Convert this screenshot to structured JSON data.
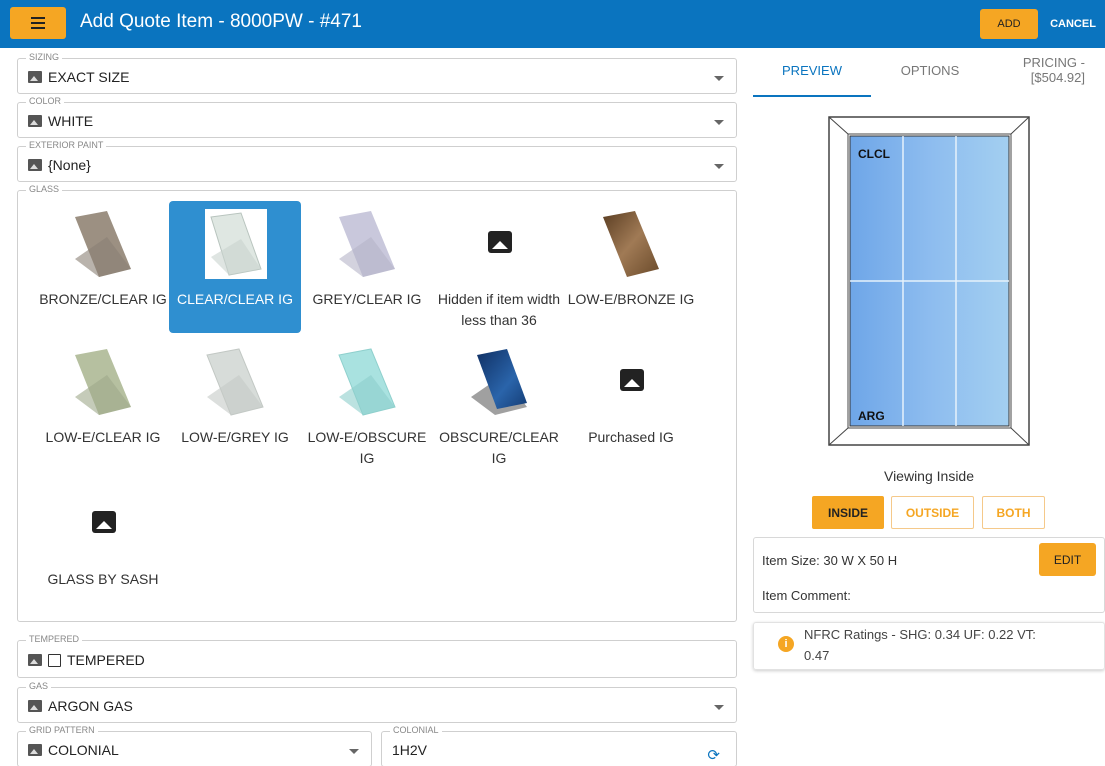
{
  "header": {
    "title": "Add Quote Item - 8000PW - #471",
    "add_label": "ADD",
    "cancel_label": "CANCEL"
  },
  "fields": {
    "sizing": {
      "label": "SIZING",
      "value": "EXACT SIZE"
    },
    "color": {
      "label": "COLOR",
      "value": "WHITE"
    },
    "exterior_paint": {
      "label": "EXTERIOR PAINT",
      "value": "{None}"
    },
    "glass": {
      "label": "GLASS"
    },
    "tempered": {
      "label": "TEMPERED",
      "value": "TEMPERED",
      "checked": false
    },
    "gas": {
      "label": "GAS",
      "value": "ARGON GAS"
    },
    "grid_pattern": {
      "label": "GRID PATTERN",
      "value": "COLONIAL"
    },
    "colonial": {
      "label": "COLONIAL",
      "value": "1H2V"
    }
  },
  "glass_options": [
    {
      "label": "BRONZE/CLEAR IG",
      "icon": "bronze-glass-swatch",
      "color": "#a09486"
    },
    {
      "label": "CLEAR/CLEAR IG",
      "icon": "clear-glass-swatch",
      "color": "#e6ece8",
      "selected": true
    },
    {
      "label": "GREY/CLEAR IG",
      "icon": "grey-glass-swatch",
      "color": "#c8c8dc"
    },
    {
      "label": "Hidden if item width less than 36",
      "icon": "image-placeholder-icon"
    },
    {
      "label": "LOW-E/BRONZE IG",
      "icon": "lowe-bronze-swatch",
      "color": "#7a5a3a"
    },
    {
      "label": "LOW-E/CLEAR IG",
      "icon": "lowe-clear-swatch",
      "color": "#b9c2a4"
    },
    {
      "label": "LOW-E/GREY IG",
      "icon": "lowe-grey-swatch",
      "color": "#d6dbd8"
    },
    {
      "label": "LOW-E/OBSCURE IG",
      "icon": "lowe-obscure-swatch",
      "color": "#a9e3e2"
    },
    {
      "label": "OBSCURE/CLEAR IG",
      "icon": "obscure-glass-swatch",
      "color": "#1d4e8c"
    },
    {
      "label": "Purchased IG",
      "icon": "image-placeholder-icon"
    },
    {
      "label": "GLASS BY SASH",
      "icon": "image-placeholder-icon"
    }
  ],
  "tabs": {
    "preview": "PREVIEW",
    "options": "OPTIONS",
    "pricing": "PRICING -",
    "pricing_value": "[$504.92]"
  },
  "preview": {
    "top_label": "CLCL",
    "bottom_label": "ARG",
    "viewing_text": "Viewing Inside"
  },
  "view_buttons": {
    "inside": "INSIDE",
    "outside": "OUTSIDE",
    "both": "BOTH"
  },
  "item": {
    "size_text": "Item Size:  30 W X 50 H",
    "edit_label": "EDIT",
    "comment_label": "Item Comment:"
  },
  "nfrc": {
    "line1": "NFRC Ratings - SHG: 0.34 UF: 0.22 VT:",
    "line2": "0.47"
  },
  "colors": {
    "primary": "#0a74bf",
    "accent": "#f5a623",
    "selected": "#2f8fd0"
  }
}
